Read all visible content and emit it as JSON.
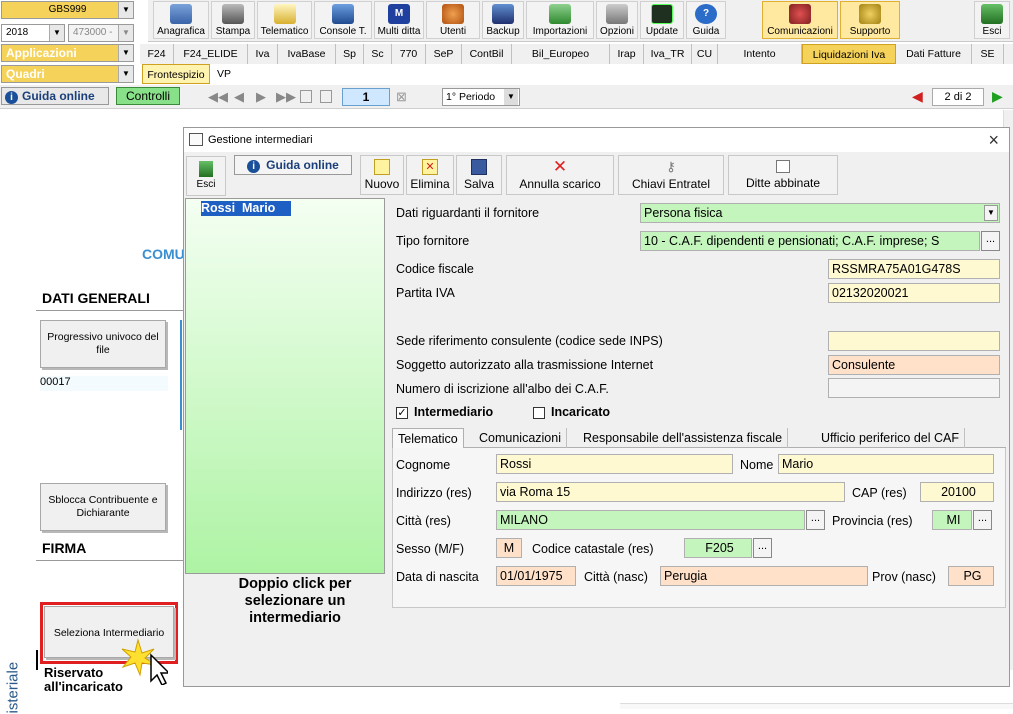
{
  "topleft": {
    "company_code": "GBS999",
    "year": "2018",
    "code2": "473000 -",
    "applicazioni": "Applicazioni",
    "quadri": "Quadri"
  },
  "toolbar": [
    {
      "label": "Anagrafica",
      "icon": "anagrafica-icon"
    },
    {
      "label": "Stampa",
      "icon": "printer-icon"
    },
    {
      "label": "Telematico",
      "icon": "telematico-icon"
    },
    {
      "label": "Console T.",
      "icon": "console-icon"
    },
    {
      "label": "Multi ditta",
      "icon": "multiditta-icon"
    },
    {
      "label": "Utenti",
      "icon": "users-icon"
    },
    {
      "label": "Backup",
      "icon": "backup-icon"
    },
    {
      "label": "Importazioni",
      "icon": "import-icon"
    },
    {
      "label": "Opzioni",
      "icon": "wrench-icon"
    },
    {
      "label": "Update",
      "icon": "update-icon"
    },
    {
      "label": "Guida",
      "icon": "help-icon"
    },
    {
      "label": "Comunicazioni",
      "icon": "comunicazioni-icon"
    },
    {
      "label": "Supporto",
      "icon": "supporto-icon"
    },
    {
      "label": "Esci",
      "icon": "exit-icon"
    }
  ],
  "tabs": [
    "F24",
    "F24_ELIDE",
    "Iva",
    "IvaBase",
    "Sp",
    "Sc",
    "770",
    "SeP",
    "ContBil",
    "Bil_Europeo",
    "Irap",
    "Iva_TR",
    "CU",
    "Intento",
    "Liquidazioni Iva",
    "Dati Fatture",
    "SE"
  ],
  "subtabs": [
    "Frontespizio",
    "VP"
  ],
  "nav": {
    "guida_online": "Guida online",
    "controlli": "Controlli",
    "page_number": "1",
    "periodo": "1° Periodo",
    "page_of": "2 di 2"
  },
  "background": {
    "comu": "COMU",
    "dati_generali": "DATI GENERALI",
    "progressivo_btn": "Progressivo univoco del file",
    "progressivo_value": "00017",
    "sblocca_btn": "Sblocca Contribuente e Dichiarante",
    "firma": "FIRMA",
    "seleziona_btn": "Seleziona Intermediario",
    "riservato": "Riservato all'incaricato",
    "side_vertical": "isteriale"
  },
  "dialog": {
    "title": "Gestione intermediari",
    "close": "×",
    "esci": "Esci",
    "guida_online": "Guida online",
    "buttons": {
      "nuovo": "Nuovo",
      "elimina": "Elimina",
      "salva": "Salva",
      "annulla": "Annulla scarico",
      "chiavi": "Chiavi Entratel",
      "ditte": "Ditte abbinate"
    },
    "list": [
      "Rossi  Mario"
    ],
    "list_hint": "Doppio click per selezionare un intermediario",
    "form": {
      "dati_fornitore_label": "Dati riguardanti il fornitore",
      "dati_fornitore_value": "Persona fisica",
      "tipo_fornitore_label": "Tipo fornitore",
      "tipo_fornitore_value": "10 - C.A.F. dipendenti e pensionati; C.A.F. imprese; S",
      "codice_fiscale_label": "Codice fiscale",
      "codice_fiscale_value": "RSSMRA75A01G478S",
      "partita_iva_label": "Partita IVA",
      "partita_iva_value": "02132020021",
      "sede_label": "Sede riferimento consulente (codice sede INPS)",
      "sede_value": "",
      "soggetto_label": "Soggetto autorizzato alla trasmissione Internet",
      "soggetto_value": "Consulente",
      "numero_label": "Numero di iscrizione all'albo dei C.A.F.",
      "numero_value": "",
      "intermediario_label": "Intermediario",
      "intermediario_checked": true,
      "incaricato_label": "Incaricato",
      "incaricato_checked": false
    },
    "inner_tabs": [
      "Telematico",
      "Comunicazioni",
      "Responsabile dell'assistenza fiscale",
      "Ufficio periferico del CAF"
    ],
    "person": {
      "cognome_label": "Cognome",
      "cognome_value": "Rossi",
      "nome_label": "Nome",
      "nome_value": "Mario",
      "indirizzo_label": "Indirizzo (res)",
      "indirizzo_value": "via Roma 15",
      "cap_label": "CAP (res)",
      "cap_value": "20100",
      "citta_label": "Città (res)",
      "citta_value": "MILANO",
      "provincia_label": "Provincia (res)",
      "provincia_value": "MI",
      "sesso_label": "Sesso (M/F)",
      "sesso_value": "M",
      "codcat_label": "Codice catastale (res)",
      "codcat_value": "F205",
      "nascita_label": "Data di nascita",
      "nascita_value": "01/01/1975",
      "cittanasc_label": "Città (nasc)",
      "cittanasc_value": "Perugia",
      "provnasc_label": "Prov (nasc)",
      "provnasc_value": "PG"
    }
  }
}
